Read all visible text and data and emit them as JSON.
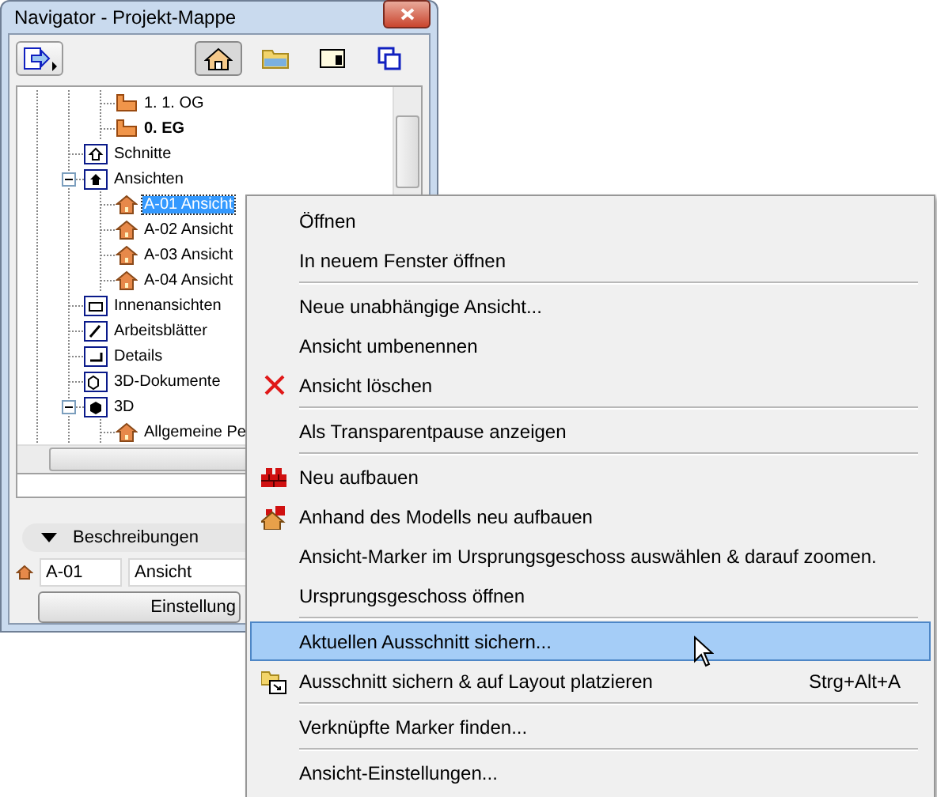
{
  "window": {
    "title": "Navigator - Projekt-Mappe"
  },
  "toolbar": {
    "views": [
      {
        "kind": "project",
        "selected": true
      },
      {
        "kind": "layout",
        "selected": false
      },
      {
        "kind": "publisher",
        "selected": false
      },
      {
        "kind": "organizer",
        "selected": false
      }
    ]
  },
  "tree": {
    "continued": [
      {
        "label": "1. 1. OG",
        "kind": "storey",
        "bold": false,
        "selected": false
      },
      {
        "label": "0. EG",
        "kind": "storey",
        "bold": true,
        "selected": false
      }
    ],
    "items": [
      {
        "label": "Schnitte",
        "kind": "section",
        "selected": false
      },
      {
        "label": "Ansichten",
        "kind": "elevation",
        "selected": false,
        "expanded": true,
        "children": [
          {
            "label": "A-01 Ansicht",
            "kind": "view",
            "selected": true
          },
          {
            "label": "A-02 Ansicht",
            "kind": "view",
            "selected": false
          },
          {
            "label": "A-03 Ansicht",
            "kind": "view",
            "selected": false
          },
          {
            "label": "A-04 Ansicht",
            "kind": "view",
            "selected": false
          }
        ]
      },
      {
        "label": "Innenansichten",
        "kind": "interior",
        "selected": false
      },
      {
        "label": "Arbeitsblätter",
        "kind": "worksheet",
        "selected": false
      },
      {
        "label": "Details",
        "kind": "detail",
        "selected": false
      },
      {
        "label": "3D-Dokumente",
        "kind": "document3d",
        "selected": false
      },
      {
        "label": "3D",
        "kind": "model3d",
        "selected": false,
        "expanded": true,
        "children": [
          {
            "label": "Allgemeine Pe",
            "kind": "view",
            "selected": false
          }
        ]
      }
    ]
  },
  "descriptions": {
    "title": "Beschreibungen",
    "expanded": true,
    "id": "A-01",
    "name": "Ansicht"
  },
  "settings_button": "Einstellung",
  "context_menu": {
    "items": [
      {
        "kind": "plain",
        "label": "Öffnen",
        "selected": false
      },
      {
        "kind": "plain",
        "label": "In neuem Fenster öffnen",
        "selected": false
      },
      {
        "kind": "separator"
      },
      {
        "kind": "plain",
        "label": "Neue unabhängige Ansicht...",
        "selected": false
      },
      {
        "kind": "plain",
        "label": "Ansicht umbenennen",
        "selected": false
      },
      {
        "kind": "delete",
        "label": "Ansicht löschen",
        "selected": false
      },
      {
        "kind": "separator"
      },
      {
        "kind": "plain",
        "label": "Als Transparentpause anzeigen",
        "selected": false
      },
      {
        "kind": "separator"
      },
      {
        "kind": "rebuild",
        "label": "Neu aufbauen",
        "selected": false
      },
      {
        "kind": "rebuild-model",
        "label": "Anhand des Modells neu aufbauen",
        "selected": false
      },
      {
        "kind": "plain",
        "label": "Ansicht-Marker im Ursprungsgeschoss auswählen & darauf zoomen.",
        "selected": false
      },
      {
        "kind": "plain",
        "label": "Ursprungsgeschoss öffnen",
        "selected": false
      },
      {
        "kind": "separator"
      },
      {
        "kind": "plain",
        "label": "Aktuellen Ausschnitt sichern...",
        "selected": true
      },
      {
        "kind": "place",
        "label": "Ausschnitt sichern & auf Layout platzieren",
        "selected": false,
        "shortcut": "Strg+Alt+A"
      },
      {
        "kind": "separator"
      },
      {
        "kind": "plain",
        "label": "Verknüpfte Marker finden...",
        "selected": false
      },
      {
        "kind": "separator"
      },
      {
        "kind": "plain",
        "label": "Ansicht-Einstellungen...",
        "selected": false
      }
    ]
  }
}
